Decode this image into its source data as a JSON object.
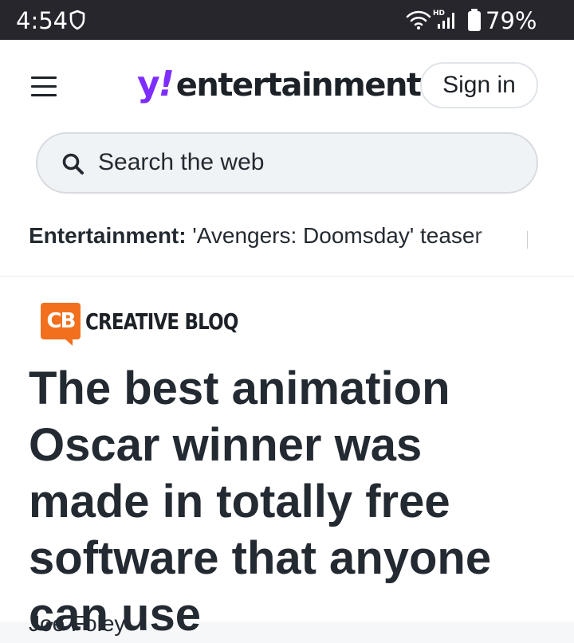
{
  "status_bar": {
    "time": "4:54",
    "battery_level": "79%",
    "network_badge": "HD",
    "icons": [
      "shield-icon",
      "wifi-icon",
      "signal-icon",
      "battery-icon"
    ]
  },
  "header": {
    "logo": {
      "y": "y",
      "bang": "!",
      "word": "entertainment"
    },
    "sign_in_label": "Sign in",
    "search": {
      "placeholder": "Search the web"
    },
    "ticker": {
      "label": "Entertainment:",
      "text": "'Avengers: Doomsday' teaser"
    }
  },
  "article": {
    "publisher": {
      "badge": "CB",
      "name": "CREATIVE BLOQ"
    },
    "headline": "The best animation Oscar winner was made in totally free software that anyone can use",
    "byline": "Joe Foley"
  },
  "colors": {
    "status_bar_bg": "#27262d",
    "yahoo_purple": "#7d2eff",
    "creative_bloq_orange": "#f2701d",
    "text_dark": "#232a31"
  }
}
